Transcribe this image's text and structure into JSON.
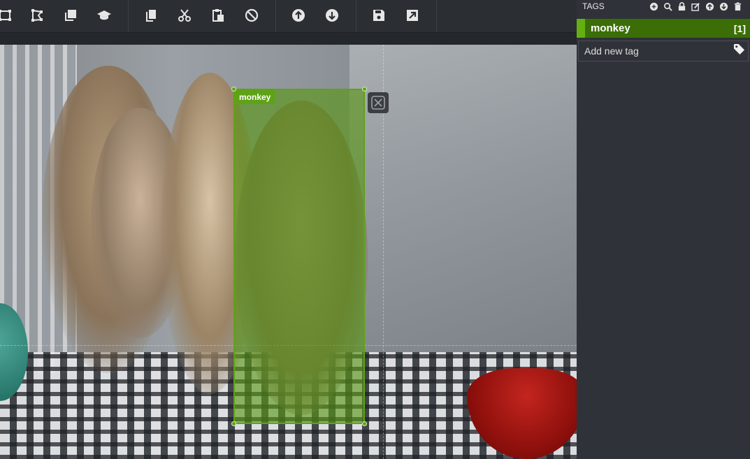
{
  "toolbar": {
    "groups": [
      [
        {
          "name": "draw-rectangle-icon"
        },
        {
          "name": "draw-polygon-icon"
        },
        {
          "name": "copy-rectangle-icon"
        },
        {
          "name": "active-learning-icon"
        }
      ],
      [
        {
          "name": "copy-regions-icon"
        },
        {
          "name": "cut-regions-icon"
        },
        {
          "name": "paste-regions-icon"
        },
        {
          "name": "clear-regions-icon"
        }
      ],
      [
        {
          "name": "previous-asset-icon"
        },
        {
          "name": "next-asset-icon"
        }
      ],
      [
        {
          "name": "save-project-icon"
        },
        {
          "name": "export-project-icon"
        }
      ]
    ]
  },
  "region": {
    "tag": "monkey",
    "color": "#5ea215"
  },
  "sidebar": {
    "header": "TAGS",
    "tools": [
      "add-tag-icon",
      "search-tags-icon",
      "lock-tag-icon",
      "edit-tag-icon",
      "move-tag-up-icon",
      "move-tag-down-icon",
      "delete-tag-icon"
    ],
    "tags": [
      {
        "name": "monkey",
        "count": "[1]",
        "color": "#64b012"
      }
    ],
    "new_tag_placeholder": "Add new tag"
  }
}
